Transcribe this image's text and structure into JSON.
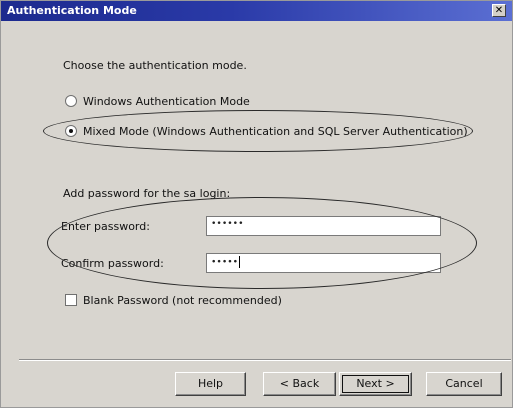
{
  "dialog": {
    "title": "Authentication Mode",
    "close_glyph": "✕"
  },
  "auth": {
    "prompt": "Choose the authentication mode.",
    "options": [
      {
        "label": "Windows Authentication Mode",
        "selected": false
      },
      {
        "label": "Mixed Mode (Windows Authentication and SQL Server Authentication)",
        "selected": true
      }
    ]
  },
  "password": {
    "section_label": "Add password for the sa login:",
    "enter_label": "Enter password:",
    "enter_value": "••••••",
    "confirm_label": "Confirm password:",
    "confirm_value": "•••••",
    "blank_label": "Blank Password (not recommended)",
    "blank_checked": false
  },
  "buttons": {
    "help": "Help",
    "back": "< Back",
    "next": "Next >",
    "cancel": "Cancel"
  },
  "annotation_color": "#2a2a2a",
  "title_bar_color": "#1c2a8e"
}
